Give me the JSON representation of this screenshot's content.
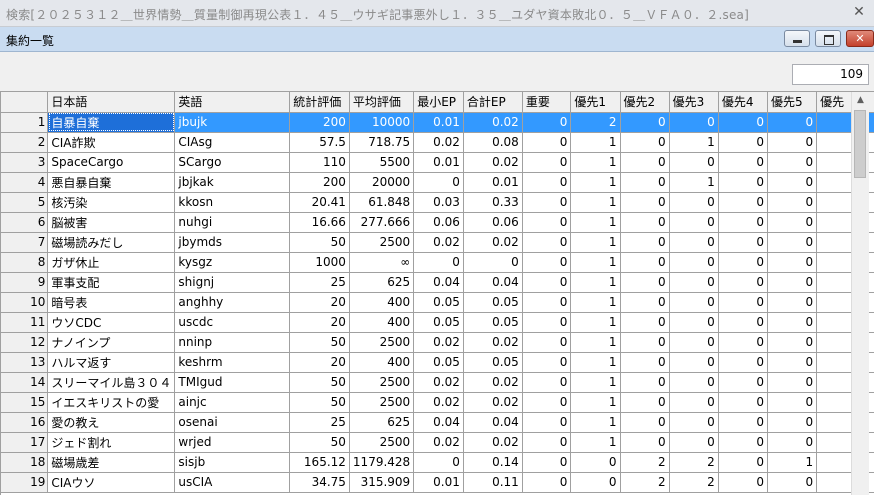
{
  "outer_window": {
    "title": "検索[２０２５３１２＿世界情勢＿質量制御再現公表１．４５＿ウサギ記事悪外し１．３５＿ユダヤ資本敗北０．５＿ＶＦＡ０．２.sea]"
  },
  "window": {
    "title": "集約一覧"
  },
  "result_count": "109",
  "selected_cell": "自暴自棄",
  "table": {
    "headers": [
      "",
      "日本語",
      "英語",
      "統計評価",
      "平均評価",
      "最小EP",
      "合計EP",
      "重要",
      "優先1",
      "優先2",
      "優先3",
      "優先4",
      "優先5",
      "優先"
    ],
    "rows": [
      [
        "1",
        "自暴自棄",
        "jbujk",
        "200",
        "10000",
        "0.01",
        "0.02",
        "0",
        "2",
        "0",
        "0",
        "0",
        "0",
        ""
      ],
      [
        "2",
        "CIA詐欺",
        "CIAsg",
        "57.5",
        "718.75",
        "0.02",
        "0.08",
        "0",
        "1",
        "0",
        "1",
        "0",
        "0",
        ""
      ],
      [
        "3",
        "SpaceCargo",
        "SCargo",
        "110",
        "5500",
        "0.01",
        "0.02",
        "0",
        "1",
        "0",
        "0",
        "0",
        "0",
        ""
      ],
      [
        "4",
        "悪自暴自棄",
        "jbjkak",
        "200",
        "20000",
        "0",
        "0.01",
        "0",
        "1",
        "0",
        "1",
        "0",
        "0",
        ""
      ],
      [
        "5",
        "核汚染",
        "kkosn",
        "20.41",
        "61.848",
        "0.03",
        "0.33",
        "0",
        "1",
        "0",
        "0",
        "0",
        "0",
        ""
      ],
      [
        "6",
        "脳被害",
        "nuhgi",
        "16.66",
        "277.666",
        "0.06",
        "0.06",
        "0",
        "1",
        "0",
        "0",
        "0",
        "0",
        ""
      ],
      [
        "7",
        "磁場読みだし",
        "jbymds",
        "50",
        "2500",
        "0.02",
        "0.02",
        "0",
        "1",
        "0",
        "0",
        "0",
        "0",
        ""
      ],
      [
        "8",
        "ガザ休止",
        "kysgz",
        "1000",
        "∞",
        "0",
        "0",
        "0",
        "1",
        "0",
        "0",
        "0",
        "0",
        ""
      ],
      [
        "9",
        "軍事支配",
        "shignj",
        "25",
        "625",
        "0.04",
        "0.04",
        "0",
        "1",
        "0",
        "0",
        "0",
        "0",
        ""
      ],
      [
        "10",
        "暗号表",
        "anghhy",
        "20",
        "400",
        "0.05",
        "0.05",
        "0",
        "1",
        "0",
        "0",
        "0",
        "0",
        ""
      ],
      [
        "11",
        "ウソCDC",
        "uscdc",
        "20",
        "400",
        "0.05",
        "0.05",
        "0",
        "1",
        "0",
        "0",
        "0",
        "0",
        ""
      ],
      [
        "12",
        "ナノインプ",
        "nninp",
        "50",
        "2500",
        "0.02",
        "0.02",
        "0",
        "1",
        "0",
        "0",
        "0",
        "0",
        ""
      ],
      [
        "13",
        "ハルマ返す",
        "keshrm",
        "20",
        "400",
        "0.05",
        "0.05",
        "0",
        "1",
        "0",
        "0",
        "0",
        "0",
        ""
      ],
      [
        "14",
        "スリーマイル島３０４",
        "TMIgud",
        "50",
        "2500",
        "0.02",
        "0.02",
        "0",
        "1",
        "0",
        "0",
        "0",
        "0",
        ""
      ],
      [
        "15",
        "イエスキリストの愛",
        "ainjc",
        "50",
        "2500",
        "0.02",
        "0.02",
        "0",
        "1",
        "0",
        "0",
        "0",
        "0",
        ""
      ],
      [
        "16",
        "愛の教え",
        "osenai",
        "25",
        "625",
        "0.04",
        "0.04",
        "0",
        "1",
        "0",
        "0",
        "0",
        "0",
        ""
      ],
      [
        "17",
        "ジェド割れ",
        "wrjed",
        "50",
        "2500",
        "0.02",
        "0.02",
        "0",
        "1",
        "0",
        "0",
        "0",
        "0",
        ""
      ],
      [
        "18",
        "磁場歳差",
        "sisjb",
        "165.12",
        "1179.428",
        "0",
        "0.14",
        "0",
        "0",
        "2",
        "2",
        "0",
        "1",
        ""
      ],
      [
        "19",
        "CIAウソ",
        "usCIA",
        "34.75",
        "315.909",
        "0.01",
        "0.11",
        "0",
        "0",
        "2",
        "2",
        "0",
        "0",
        ""
      ]
    ]
  }
}
